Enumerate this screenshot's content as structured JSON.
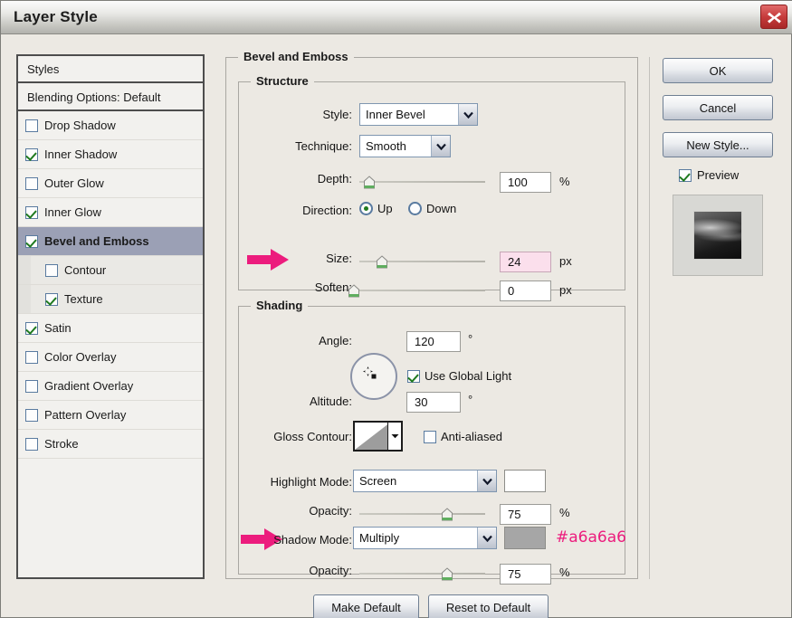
{
  "window": {
    "title": "Layer Style",
    "close_icon": "close-x-icon"
  },
  "styles_panel": {
    "header": "Styles",
    "blending_options": "Blending Options: Default",
    "items": [
      {
        "label": "Drop Shadow",
        "checked": false,
        "selected": false,
        "sub": false
      },
      {
        "label": "Inner Shadow",
        "checked": true,
        "selected": false,
        "sub": false
      },
      {
        "label": "Outer Glow",
        "checked": false,
        "selected": false,
        "sub": false
      },
      {
        "label": "Inner Glow",
        "checked": true,
        "selected": false,
        "sub": false
      },
      {
        "label": "Bevel and Emboss",
        "checked": true,
        "selected": true,
        "sub": false
      },
      {
        "label": "Contour",
        "checked": false,
        "selected": false,
        "sub": true
      },
      {
        "label": "Texture",
        "checked": true,
        "selected": false,
        "sub": true
      },
      {
        "label": "Satin",
        "checked": true,
        "selected": false,
        "sub": false
      },
      {
        "label": "Color Overlay",
        "checked": false,
        "selected": false,
        "sub": false
      },
      {
        "label": "Gradient Overlay",
        "checked": false,
        "selected": false,
        "sub": false
      },
      {
        "label": "Pattern Overlay",
        "checked": false,
        "selected": false,
        "sub": false
      },
      {
        "label": "Stroke",
        "checked": false,
        "selected": false,
        "sub": false
      }
    ]
  },
  "bevel": {
    "group_title": "Bevel and Emboss",
    "structure": {
      "group_title": "Structure",
      "style_label": "Style:",
      "style_value": "Inner Bevel",
      "technique_label": "Technique:",
      "technique_value": "Smooth",
      "depth_label": "Depth:",
      "depth_value": "100",
      "depth_unit": "%",
      "depth_percent": 8,
      "direction_label": "Direction:",
      "direction_up": "Up",
      "direction_down": "Down",
      "direction_selected": "Up",
      "size_label": "Size:",
      "size_value": "24",
      "size_unit": "px",
      "size_percent": 18,
      "soften_label": "Soften:",
      "soften_value": "0",
      "soften_unit": "px",
      "soften_percent": 0
    },
    "shading": {
      "group_title": "Shading",
      "angle_label": "Angle:",
      "angle_value": "120",
      "angle_unit": "°",
      "use_global_light": "Use Global Light",
      "use_global_light_checked": true,
      "altitude_label": "Altitude:",
      "altitude_value": "30",
      "altitude_unit": "°",
      "gloss_contour_label": "Gloss Contour:",
      "anti_aliased": "Anti-aliased",
      "anti_aliased_checked": false,
      "highlight_mode_label": "Highlight Mode:",
      "highlight_mode_value": "Screen",
      "highlight_color": "#ffffff",
      "highlight_opacity_label": "Opacity:",
      "highlight_opacity_value": "75",
      "highlight_opacity_unit": "%",
      "highlight_opacity_percent": 70,
      "shadow_mode_label": "Shadow Mode:",
      "shadow_mode_value": "Multiply",
      "shadow_color": "#a6a6a6",
      "shadow_opacity_label": "Opacity:",
      "shadow_opacity_value": "75",
      "shadow_opacity_unit": "%",
      "shadow_opacity_percent": 70
    },
    "make_default": "Make Default",
    "reset_to_default": "Reset to Default"
  },
  "right_column": {
    "ok": "OK",
    "cancel": "Cancel",
    "new_style": "New Style...",
    "preview": "Preview",
    "preview_checked": true
  },
  "annotations": {
    "hex_note": "#a6a6a6",
    "accent_color": "#ec1c7d",
    "arrow_size_icon": "arrow-right-icon",
    "arrow_shadow_icon": "arrow-right-icon"
  }
}
